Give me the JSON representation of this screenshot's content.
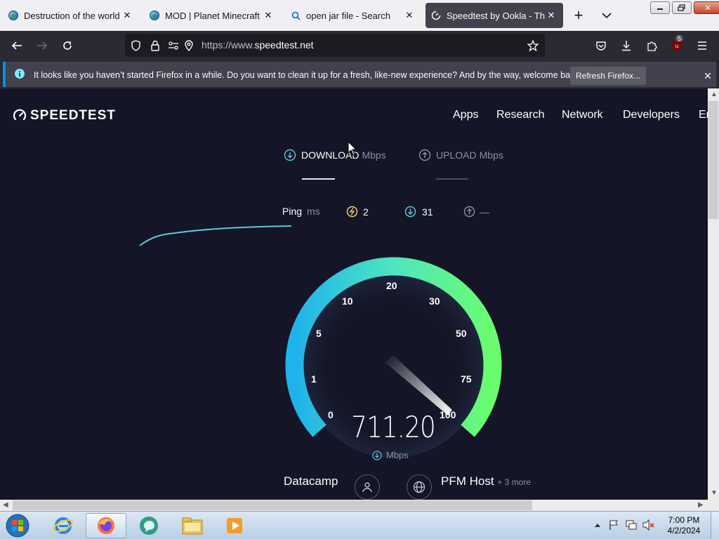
{
  "browser": {
    "tabs": [
      {
        "label": "Destruction of the world M",
        "close": "✕",
        "icon": "globe-icon"
      },
      {
        "label": "MOD | Planet Minecraft",
        "close": "✕",
        "icon": "globe-icon"
      },
      {
        "label": "open jar file - Search",
        "close": "✕",
        "icon": "search-icon"
      },
      {
        "label": "Speedtest by Ookla - The G",
        "close": "✕",
        "icon": "speedtest-icon",
        "active": true
      }
    ],
    "new_tab": "+",
    "list_tabs": "⌄",
    "window_controls": {
      "minimize": "—",
      "maximize": "❐",
      "close": "✕"
    },
    "url_prefix": "https://www.",
    "url_domain": "speedtest.net",
    "extension_badge": "5"
  },
  "notification": {
    "text": "It looks like you haven’t started Firefox in a while. Do you want to clean it up for a fresh, like-new experience? And by the way, welcome back!",
    "button": "Refresh Firefox...",
    "close": "✕"
  },
  "speedtest": {
    "logo": "SPEEDTEST",
    "nav": [
      "Apps",
      "Research",
      "Network",
      "Developers",
      "En"
    ],
    "download_label": "DOWNLOAD",
    "upload_label": "UPLOAD",
    "unit": "Mbps",
    "ping_label": "Ping",
    "ping_unit": "ms",
    "ping_idle": "2",
    "ping_download": "31",
    "ping_upload": "—",
    "gauge_labels": [
      "0",
      "1",
      "5",
      "10",
      "20",
      "30",
      "50",
      "75",
      "100"
    ],
    "speed_value": "711.20",
    "speed_unit": "Mbps",
    "isp_name": "Datacamp",
    "host_name": "PFM Host",
    "host_more": "+ 3 more",
    "colors": {
      "background": "#141526",
      "gauge_start": "#1fb2ec",
      "gauge_end": "#6afd6e",
      "accent": "#5ec9d9"
    }
  },
  "taskbar": {
    "time": "7:00 PM",
    "date": "4/2/2024",
    "apps": [
      "start-orb",
      "internet-explorer",
      "firefox",
      "app-3",
      "file-explorer",
      "media-player"
    ]
  }
}
